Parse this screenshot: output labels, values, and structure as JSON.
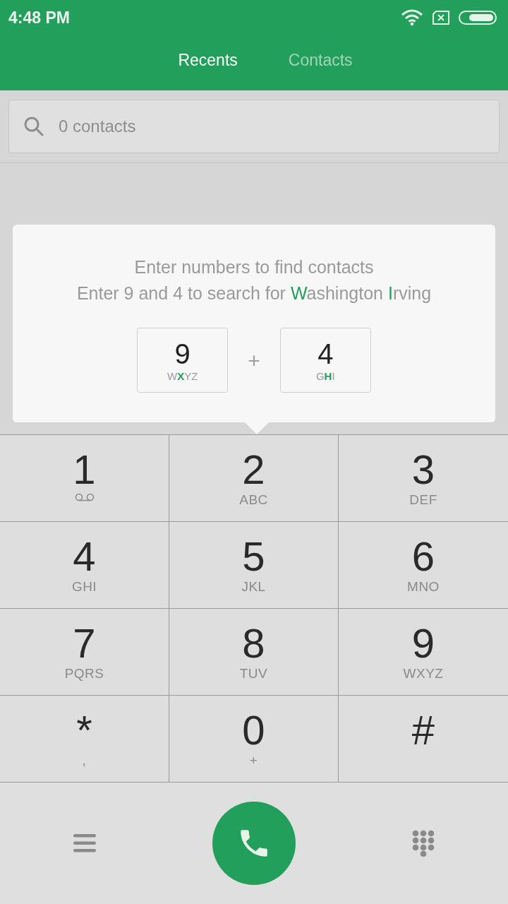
{
  "status_bar": {
    "time": "4:48 PM"
  },
  "tabs": [
    {
      "label": "Recents",
      "selected": true
    },
    {
      "label": "Contacts",
      "selected": false
    }
  ],
  "search": {
    "placeholder": "0 contacts"
  },
  "hint": {
    "line_1": [
      {
        "text": "Enter numbers to find contacts",
        "highlighted": false
      }
    ],
    "line_2": [
      {
        "text": "Enter 9 and 4 to search for ",
        "highlighted": false
      },
      {
        "text": "W",
        "highlighted": true
      },
      {
        "text": "ashington ",
        "highlighted": false
      },
      {
        "text": "I",
        "highlighted": true
      },
      {
        "text": "rving",
        "highlighted": false
      }
    ],
    "example_keys": [
      {
        "digit": "9",
        "letters": [
          {
            "text": "W",
            "highlighted": false
          },
          {
            "text": "X",
            "highlighted": true
          },
          {
            "text": "YZ",
            "highlighted": false
          }
        ]
      },
      {
        "digit": "4",
        "letters": [
          {
            "text": "G",
            "highlighted": false
          },
          {
            "text": "H",
            "highlighted": true
          },
          {
            "text": "I",
            "highlighted": false
          }
        ]
      }
    ],
    "joiner": "+"
  },
  "keypad": [
    {
      "key": "1",
      "kind": "voicemail"
    },
    {
      "key": "2",
      "kind": "letters",
      "sub": "ABC"
    },
    {
      "key": "3",
      "kind": "letters",
      "sub": "DEF"
    },
    {
      "key": "4",
      "kind": "letters",
      "sub": "GHI"
    },
    {
      "key": "5",
      "kind": "letters",
      "sub": "JKL"
    },
    {
      "key": "6",
      "kind": "letters",
      "sub": "MNO"
    },
    {
      "key": "7",
      "kind": "letters",
      "sub": "PQRS"
    },
    {
      "key": "8",
      "kind": "letters",
      "sub": "TUV"
    },
    {
      "key": "9",
      "kind": "letters",
      "sub": "WXYZ"
    },
    {
      "key": "*",
      "kind": "symbol",
      "sub": ","
    },
    {
      "key": "0",
      "kind": "letters",
      "sub": "+"
    },
    {
      "key": "#",
      "kind": "symbol"
    }
  ]
}
